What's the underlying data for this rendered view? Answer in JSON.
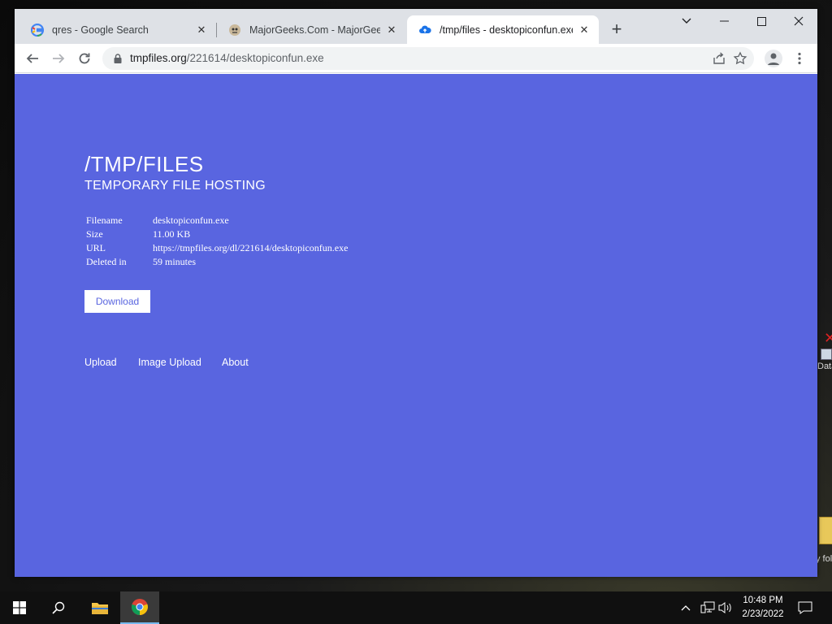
{
  "browser": {
    "tabs": [
      {
        "title": "qres - Google Search",
        "favicon": "google-icon",
        "active": false
      },
      {
        "title": "MajorGeeks.Com - MajorGeeks",
        "favicon": "majorgeeks-icon",
        "active": false
      },
      {
        "title": "/tmp/files - desktopiconfun.exe",
        "favicon": "cloud-upload-icon",
        "active": true
      }
    ],
    "address": {
      "host": "tmpfiles.org",
      "path": "/221614/desktopiconfun.exe"
    }
  },
  "page": {
    "title": "/TMP/FILES",
    "subtitle": "TEMPORARY FILE HOSTING",
    "info": [
      {
        "label": "Filename",
        "value": "desktopiconfun.exe"
      },
      {
        "label": "Size",
        "value": "11.00 KB"
      },
      {
        "label": "URL",
        "value": "https://tmpfiles.org/dl/221614/desktopiconfun.exe"
      },
      {
        "label": "Deleted in",
        "value": "59 minutes"
      }
    ],
    "download_label": "Download",
    "nav": [
      "Upload",
      "Image Upload",
      "About"
    ],
    "colors": {
      "background": "#5965e0",
      "text": "#ffffff"
    }
  },
  "desktop": {
    "icon_label_1": "Data",
    "icon_label_2": "y fol"
  },
  "taskbar": {
    "time": "10:48 PM",
    "date": "2/23/2022"
  }
}
